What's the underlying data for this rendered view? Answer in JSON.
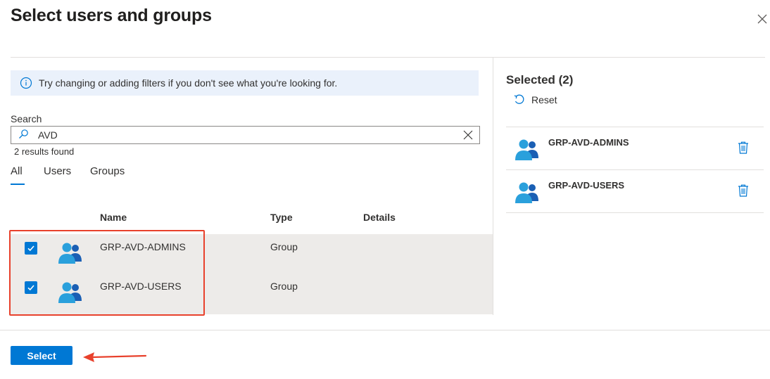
{
  "dialog": {
    "title": "Select users and groups"
  },
  "info": {
    "text": "Try changing or adding filters if you don't see what you're looking for."
  },
  "search": {
    "label": "Search",
    "value": "AVD",
    "results_text": "2 results found"
  },
  "tabs": [
    {
      "label": "All",
      "active": true
    },
    {
      "label": "Users",
      "active": false
    },
    {
      "label": "Groups",
      "active": false
    }
  ],
  "table": {
    "headers": {
      "name": "Name",
      "type": "Type",
      "details": "Details"
    },
    "rows": [
      {
        "name": "GRP-AVD-ADMINS",
        "type": "Group",
        "details": "",
        "checked": true
      },
      {
        "name": "GRP-AVD-USERS",
        "type": "Group",
        "details": "",
        "checked": true
      }
    ]
  },
  "selected": {
    "title": "Selected (2)",
    "reset_label": "Reset",
    "items": [
      {
        "name": "GRP-AVD-ADMINS"
      },
      {
        "name": "GRP-AVD-USERS"
      }
    ]
  },
  "footer": {
    "select_label": "Select"
  },
  "colors": {
    "accent": "#0078d4",
    "info_bg": "#eaf1fb",
    "row_bg": "#edebe9",
    "annotation_red": "#e8412c",
    "icon_light_blue": "#2aa0dc",
    "icon_dark_blue": "#1a5fb4"
  },
  "icons": {
    "close": "close-icon",
    "info": "info-icon",
    "search": "search-icon",
    "clear": "clear-icon",
    "checkbox": "checkmark-icon",
    "group": "group-icon",
    "reset": "undo-icon",
    "delete": "trash-icon",
    "annotation": "red-arrow-icon"
  }
}
